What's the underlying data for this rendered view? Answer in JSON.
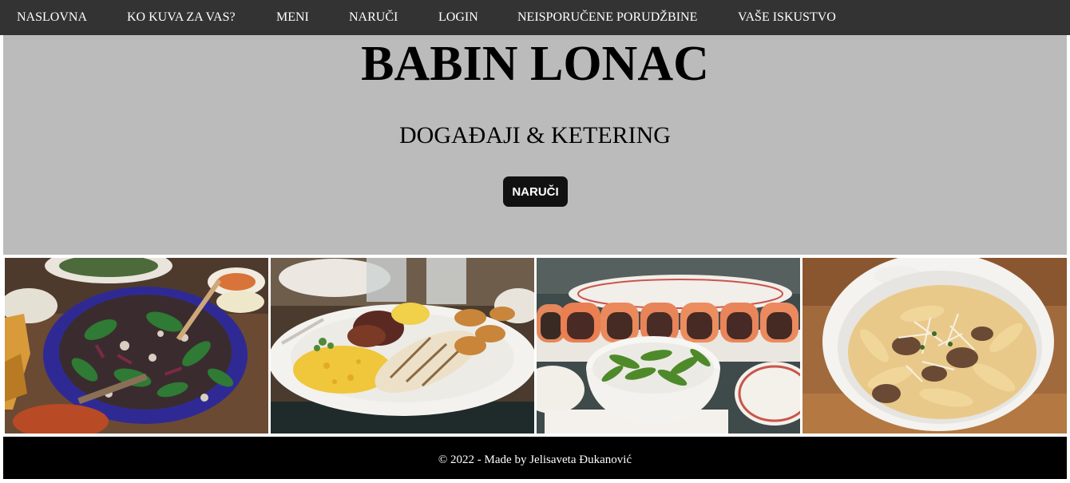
{
  "nav": {
    "items": [
      {
        "label": "NASLOVNA"
      },
      {
        "label": "KO KUVA ZA VAS?"
      },
      {
        "label": "MENI"
      },
      {
        "label": "NARUČI"
      },
      {
        "label": "LOGIN"
      },
      {
        "label": "NEISPORUČENE PORUDŽBINE"
      },
      {
        "label": "VAŠE ISKUSTVO"
      }
    ]
  },
  "hero": {
    "title": "BABIN LONAC",
    "subtitle": "DOGAĐAJI & KETERING",
    "button_label": "NARUČI"
  },
  "gallery": {
    "photos": [
      {
        "subject": "salad-bowl"
      },
      {
        "subject": "grilled-squid-plate"
      },
      {
        "subject": "sushi-and-edamame"
      },
      {
        "subject": "pasta-bowl"
      }
    ]
  },
  "footer": {
    "text": "© 2022 - Made by Jelisaveta Đukanović"
  },
  "colors": {
    "navbar": "#333333",
    "hero_background": "#bbbbbb",
    "button": "#111111",
    "footer": "#000000"
  }
}
